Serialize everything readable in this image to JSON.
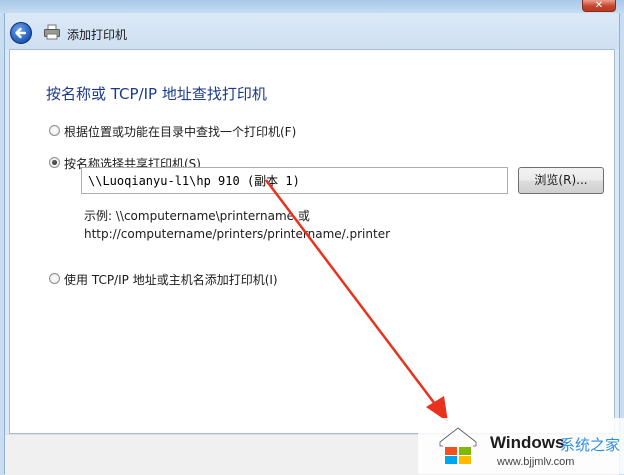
{
  "window": {
    "title": "添加打印机",
    "close_glyph": "✕"
  },
  "page": {
    "heading": "按名称或 TCP/IP 地址查找打印机"
  },
  "options": [
    {
      "label": "根据位置或功能在目录中查找一个打印机(F)",
      "selected": false
    },
    {
      "label": "按名称选择共享打印机(S)",
      "selected": true
    },
    {
      "label": "使用 TCP/IP 地址或主机名添加打印机(I)",
      "selected": false
    }
  ],
  "share_name": {
    "value": "\\\\Luoqianyu-l1\\hp 910 (副本 1)"
  },
  "browse_button": {
    "label": "浏览(R)..."
  },
  "example": {
    "line1": "示例: \\\\computername\\printername 或",
    "line2": "http://computername/printers/printername/.printer"
  },
  "watermark": {
    "brand": "Windows",
    "site": "系统之家",
    "url": "www.bjjmlv.com"
  },
  "colors": {
    "heading": "#1a3a8c",
    "annotation_arrow": "#e8321e",
    "watermark_accent": "#2d8de0"
  },
  "icons": {
    "back": "back-arrow-icon",
    "printer": "printer-icon",
    "close": "close-icon",
    "logo": "windows-logo-icon"
  }
}
